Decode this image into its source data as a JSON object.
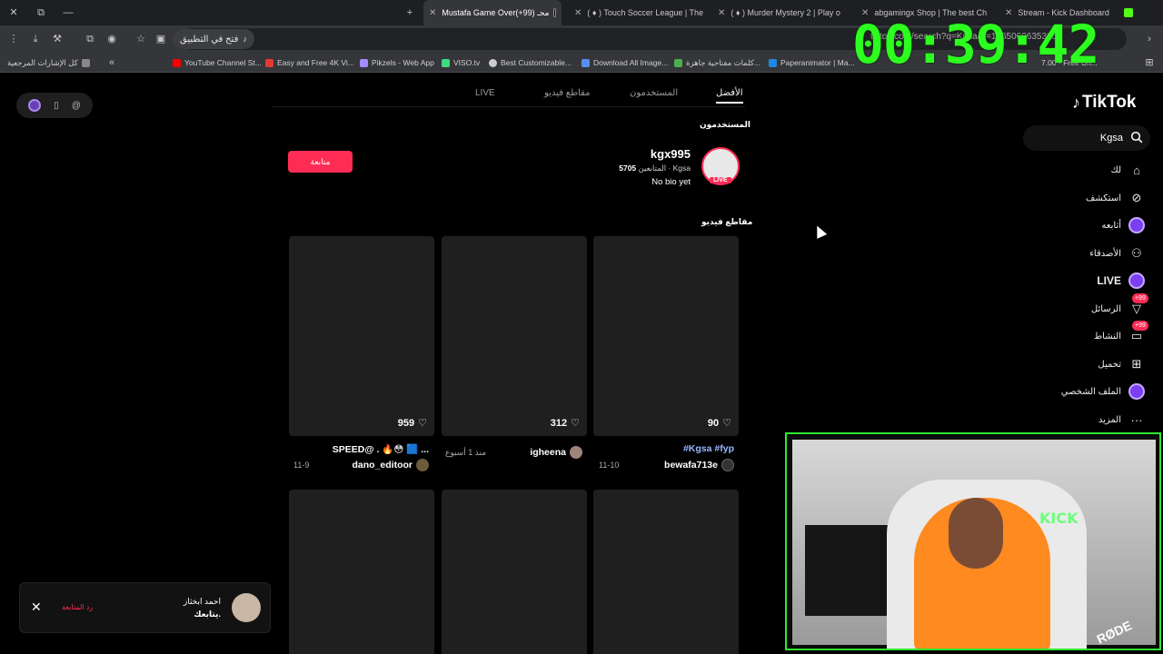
{
  "browser": {
    "tabs": [
      {
        "label": "Mustafa Game Over(+99) محـ",
        "active": true
      },
      {
        "label": "( ♦ ) Touch Soccer League | The",
        "active": false
      },
      {
        "label": "( ♦ ) Murder Mystery 2 | Play o",
        "active": false
      },
      {
        "label": "abgamingx Shop | The best Ch",
        "active": false
      },
      {
        "label": "Stream - Kick Dashboard",
        "active": false
      }
    ],
    "open_in_app": "فتح في التطبيق",
    "url": "tiktok.com/search?q=Kgsa&t=1765060635305",
    "bookmarks": [
      {
        "label": "كل الإشارات المرجعية",
        "color": "#888888"
      },
      {
        "label": "YouTube Channel St...",
        "color": "#ff0000"
      },
      {
        "label": "Easy and Free 4K Vi...",
        "color": "#e53935"
      },
      {
        "label": "Pikzels - Web App",
        "color": "#a58cff"
      },
      {
        "label": "VISO.tv",
        "color": "#3ddc84"
      },
      {
        "label": "Best Customizable...",
        "color": "#cccccc"
      },
      {
        "label": "Download All Image...",
        "color": "#5b8def"
      },
      {
        "label": "كلمات مفتاحية جاهزة...",
        "color": "#4caf50"
      },
      {
        "label": "Paperanimator | Ma...",
        "color": "#1e88e5"
      },
      {
        "label": "7.00 - Free Un...",
        "color": "#bbbbbb"
      }
    ]
  },
  "ext": {
    "items": [
      "@",
      "▯",
      ""
    ]
  },
  "tiktok": {
    "logo": "TikTok",
    "search_value": "Kgsa",
    "nav": [
      {
        "label": "لك",
        "icon": "home-icon",
        "badge": ""
      },
      {
        "label": "استكشف",
        "icon": "compass-icon",
        "badge": ""
      },
      {
        "label": "أتابعه",
        "icon": "following-icon",
        "badge": ""
      },
      {
        "label": "الأصدقاء",
        "icon": "friends-icon",
        "badge": ""
      },
      {
        "label": "LIVE",
        "icon": "live-icon",
        "badge": ""
      },
      {
        "label": "الرسائل",
        "icon": "messages-icon",
        "badge": "+99"
      },
      {
        "label": "النشاط",
        "icon": "activity-icon",
        "badge": "+99"
      },
      {
        "label": "تحميل",
        "icon": "upload-icon",
        "badge": ""
      },
      {
        "label": "الملف الشخصي",
        "icon": "profile-icon",
        "badge": ""
      },
      {
        "label": "المزيد",
        "icon": "more-icon",
        "badge": ""
      }
    ],
    "tabs": [
      "الأفضل",
      "المستخدمون",
      "مقاطع فيديو",
      "LIVE"
    ],
    "users_heading": "المستخدمون",
    "user": {
      "name": "kgx995",
      "handle": "Kgsa",
      "followers_count": "5705",
      "followers_label": "المتابعين",
      "bio": "No bio yet",
      "live_tag": "LIVE",
      "follow_label": "متابعة"
    },
    "videos_heading": "مقاطع فيديو",
    "videos": [
      {
        "likes": "90",
        "caption": "#Kgsa #fyp",
        "author": "bewafa713e",
        "date": "11-10"
      },
      {
        "likes": "312",
        "caption": "",
        "author": "igheena",
        "date": "منذ 1 أسبوع"
      },
      {
        "likes": "959",
        "caption": "SPEED@ . 🔥😳 🟦 ...",
        "author": "dano_editoor",
        "date": "11-9"
      }
    ],
    "notification": {
      "name": "احمد ابخثاز",
      "text": "يتابعك.",
      "reply": "رد المتابعة"
    }
  },
  "overlay": {
    "timer": "00:39:42",
    "webcam_sign": "KICK",
    "mic_brand": "RØDE"
  },
  "colors": {
    "accent": "#fe2c55",
    "timer": "#2cff1f",
    "webcam_border": "#2ee82e"
  }
}
